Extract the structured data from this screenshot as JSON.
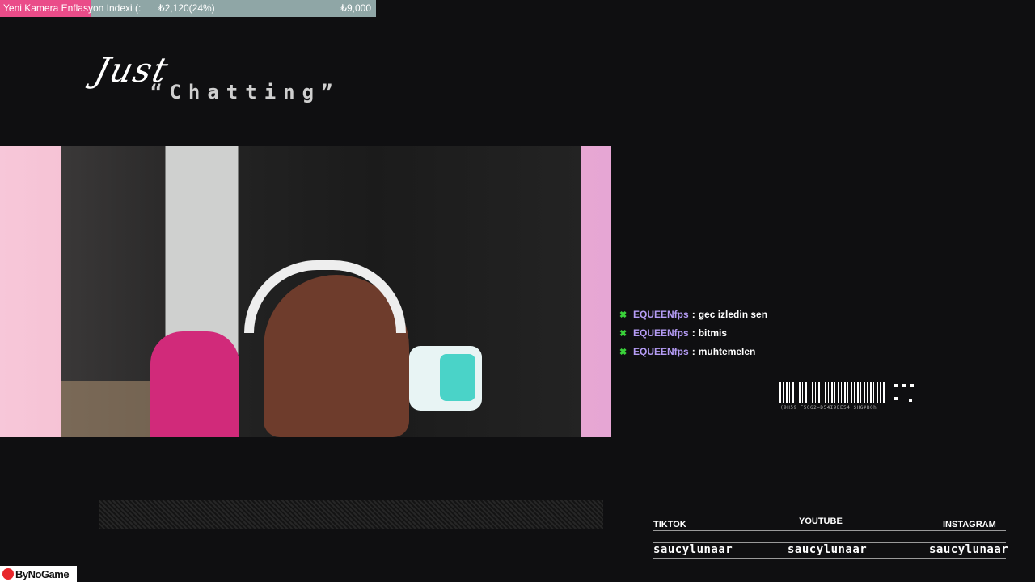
{
  "goal": {
    "title": "Yeni Kamera Enflasyon Indexi (:",
    "current": "₺2,120(24%)",
    "target": "₺9,000",
    "progress_fraction": 0.24,
    "fill_color": "#ea4c89",
    "bg_color": "#8fa6a6"
  },
  "scene_title": {
    "line1": "Just",
    "line2": "“Chatting”"
  },
  "chat": {
    "messages": [
      {
        "user": "EQUEENfps",
        "text": "gec izledin sen",
        "icon": "badge-icon"
      },
      {
        "user": "EQUEENfps",
        "text": "bitmis",
        "icon": "badge-icon"
      },
      {
        "user": "EQUEENfps",
        "text": "muhtemelen",
        "icon": "badge-icon"
      }
    ],
    "user_color": "#b59cf5",
    "badge_color": "#3ad23a"
  },
  "barcode": {
    "text": "(9H59 F50G2=D54I9EE54 SHG#B0h"
  },
  "socials": {
    "tiktok_label": "TIKTOK",
    "youtube_label": "YOUTUBE",
    "instagram_label": "INSTAGRAM",
    "tiktok_handle": "saucylunaar",
    "youtube_handle": "saucylunaar",
    "instagram_handle": "saucylunaar"
  },
  "logo": {
    "text": "ByNoGame"
  }
}
